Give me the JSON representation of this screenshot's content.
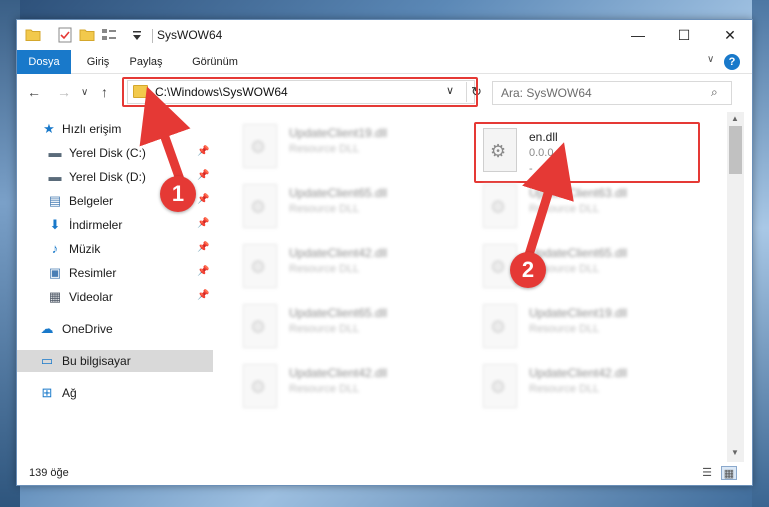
{
  "window": {
    "title": "SysWOW64",
    "minimize_glyph": "—",
    "maximize_glyph": "☐",
    "close_glyph": "✕"
  },
  "ribbon": {
    "tabs": [
      "Dosya",
      "Giriş",
      "Paylaş",
      "Görünüm"
    ],
    "collapse_glyph": "∨",
    "help_glyph": "?"
  },
  "nav": {
    "back_glyph": "←",
    "forward_glyph": "→",
    "recent_glyph": "∨",
    "up_glyph": "↑",
    "address": "C:\\Windows\\SysWOW64",
    "address_dropdown_glyph": "∨",
    "refresh_glyph": "↻",
    "search_placeholder": "Ara: SysWOW64",
    "search_glyph": "⌕"
  },
  "sidebar": {
    "items": [
      {
        "label": "Hızlı erişim",
        "icon": "star-icon",
        "glyph": "★",
        "color": "#1979ca",
        "pinned": false
      },
      {
        "label": "Yerel Disk (C:)",
        "icon": "drive-icon",
        "glyph": "▬",
        "color": "#5a6b7a",
        "pinned": true
      },
      {
        "label": "Yerel Disk (D:)",
        "icon": "drive-icon",
        "glyph": "▬",
        "color": "#5a6b7a",
        "pinned": true
      },
      {
        "label": "Belgeler",
        "icon": "documents-icon",
        "glyph": "▤",
        "color": "#4b7fb5",
        "pinned": true
      },
      {
        "label": "İndirmeler",
        "icon": "download-icon",
        "glyph": "⬇",
        "color": "#1979ca",
        "pinned": true
      },
      {
        "label": "Müzik",
        "icon": "music-icon",
        "glyph": "♪",
        "color": "#1979ca",
        "pinned": true
      },
      {
        "label": "Resimler",
        "icon": "pictures-icon",
        "glyph": "▣",
        "color": "#4b7fb5",
        "pinned": true
      },
      {
        "label": "Videolar",
        "icon": "videos-icon",
        "glyph": "▦",
        "color": "#4b5563",
        "pinned": true
      },
      {
        "label": "OneDrive",
        "icon": "cloud-icon",
        "glyph": "☁",
        "color": "#1979ca",
        "pinned": false
      },
      {
        "label": "Bu bilgisayar",
        "icon": "computer-icon",
        "glyph": "▭",
        "color": "#1979ca",
        "pinned": false
      },
      {
        "label": "Ağ",
        "icon": "network-icon",
        "glyph": "⊞",
        "color": "#1979ca",
        "pinned": false
      }
    ],
    "pin_glyph": "📌"
  },
  "files": {
    "left_column": [
      {
        "name": "UpdateClient19.dll",
        "desc": "Resource DLL"
      },
      {
        "name": "UpdateClient65.dll",
        "desc": "Resource DLL"
      },
      {
        "name": "UpdateClient42.dll",
        "desc": "Resource DLL"
      },
      {
        "name": "UpdateClient65.dll",
        "desc": "Resource DLL"
      },
      {
        "name": "UpdateClient42.dll",
        "desc": "Resource DLL"
      }
    ],
    "right_column": [
      {
        "name": "en.dll",
        "desc": "0.0.0.0",
        "extra": "-"
      },
      {
        "name": "UpdateClient63.dll",
        "desc": "Resource DLL"
      },
      {
        "name": "UpdateClient65.dll",
        "desc": "Resource DLL"
      },
      {
        "name": "UpdateClient19.dll",
        "desc": "Resource DLL"
      },
      {
        "name": "UpdateClient42.dll",
        "desc": "Resource DLL"
      }
    ],
    "gear_glyph": "⚙"
  },
  "status": {
    "count": "139 öğe"
  },
  "annotations": {
    "badge_1": "1",
    "badge_2": "2",
    "color": "#e53935"
  }
}
